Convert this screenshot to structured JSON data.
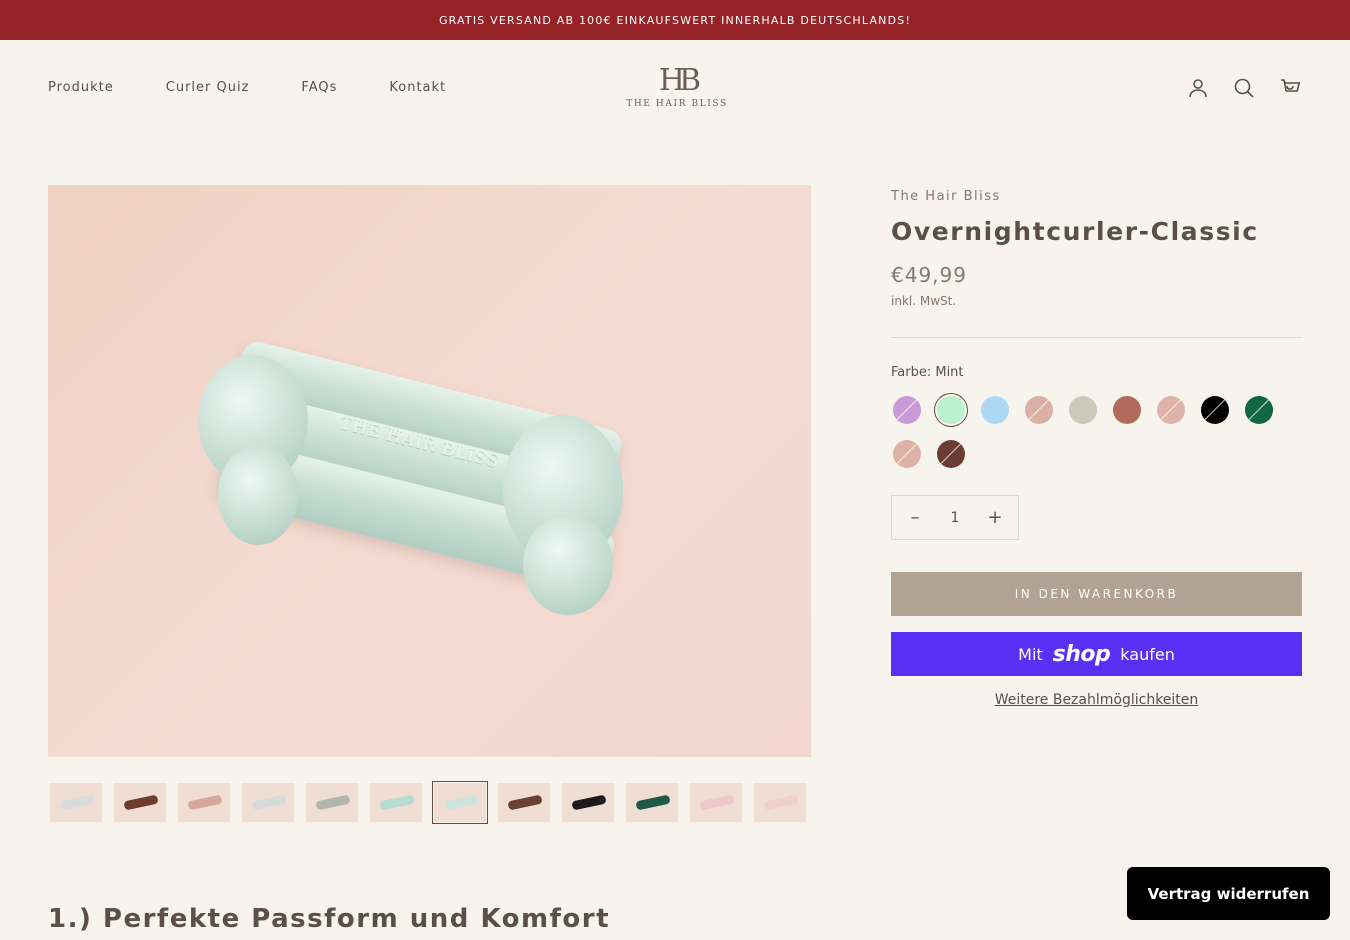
{
  "announcement": "GRATIS VERSAND AB 100€ EINKAUFSWERT INNERHALB DEUTSCHLANDS!",
  "nav": {
    "items": [
      "Produkte",
      "Curler Quiz",
      "FAQs",
      "Kontakt"
    ]
  },
  "logo": {
    "monogram": "HB",
    "wordmark": "THE HAIR BLISS"
  },
  "header_icons": [
    "account-icon",
    "search-icon",
    "cart-icon"
  ],
  "hero": {
    "embossed_text": "THE HAIR BLISS"
  },
  "thumbnails": {
    "count": 12,
    "selected_index": 6,
    "bar_colors": [
      "#d8dddb",
      "#6e3b2d",
      "#d8a79c",
      "#d5dcd8",
      "#b0b5ae",
      "#b8dbd3",
      "#cfe3dd",
      "#6a4032",
      "#1b1b1b",
      "#1d5a45",
      "#efc8cc",
      "#f1cfcd"
    ]
  },
  "product": {
    "brand": "The Hair Bliss",
    "title": "Overnightcurler-Classic",
    "price": "€49,99",
    "tax_note": "inkl. MwSt.",
    "color_label": "Farbe: Mint",
    "swatches": [
      {
        "color": "#c89bd6",
        "crossed": true,
        "selected": false
      },
      {
        "color": "#b9f2cc",
        "crossed": false,
        "selected": true
      },
      {
        "color": "#acd8f6",
        "crossed": false,
        "selected": false
      },
      {
        "color": "#dcb1a5",
        "crossed": true,
        "selected": false
      },
      {
        "color": "#cbc8bc",
        "crossed": false,
        "selected": false
      },
      {
        "color": "#b16b5a",
        "crossed": false,
        "selected": false
      },
      {
        "color": "#dfb4a8",
        "crossed": true,
        "selected": false
      },
      {
        "color": "#000000",
        "crossed": true,
        "selected": false
      },
      {
        "color": "#0f6745",
        "crossed": true,
        "selected": false
      },
      {
        "color": "#ddb3a5",
        "crossed": true,
        "selected": false
      },
      {
        "color": "#6a3c33",
        "crossed": true,
        "selected": false
      }
    ],
    "quantity": "1",
    "decrease_symbol": "–",
    "increase_symbol": "+",
    "add_to_cart": "IN DEN WARENKORB",
    "shop_pay": {
      "prefix": "Mit",
      "brand": "shop",
      "suffix": "kaufen",
      "color": "#5a31f4"
    },
    "more_payments": "Weitere Bezahlmöglichkeiten"
  },
  "section_heading": "1.) Perfekte Passform und Komfort",
  "revoke_button": "Vertrag widerrufen",
  "colors": {
    "announcement_bg": "#952226",
    "page_bg": "#f7f4ee",
    "cart_button": "#b1a294",
    "text": "#5b4f48"
  }
}
